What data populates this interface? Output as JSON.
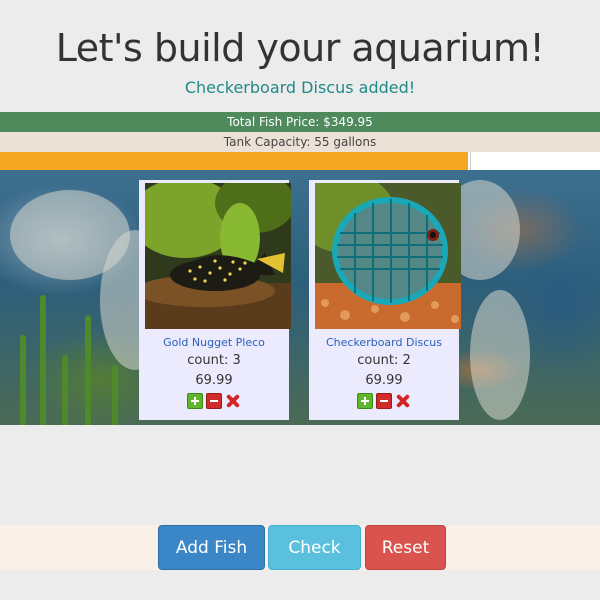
{
  "header": {
    "title": "Let's build your aquarium!",
    "message": "Checkerboard Discus added!"
  },
  "summary": {
    "total_price_label": "Total Fish Price: $349.95",
    "tank_capacity_label": "Tank Capacity: 55 gallons",
    "capacity_progress_percent": 78,
    "progress_color": "#f5a623"
  },
  "fish": [
    {
      "name": "Gold Nugget Pleco",
      "count_label": "count: 3",
      "price": "69.99",
      "icons": [
        "plus-icon",
        "minus-icon",
        "remove-icon"
      ]
    },
    {
      "name": "Checkerboard Discus",
      "count_label": "count: 2",
      "price": "69.99",
      "icons": [
        "plus-icon",
        "minus-icon",
        "remove-icon"
      ]
    }
  ],
  "actions": {
    "add_fish": "Add Fish",
    "check": "Check",
    "reset": "Reset"
  },
  "colors": {
    "message": "#1f8a87",
    "price_bar": "#4e8a5b",
    "add_button": "#3b86c6",
    "check_button": "#5bc0de",
    "reset_button": "#d9534f"
  }
}
